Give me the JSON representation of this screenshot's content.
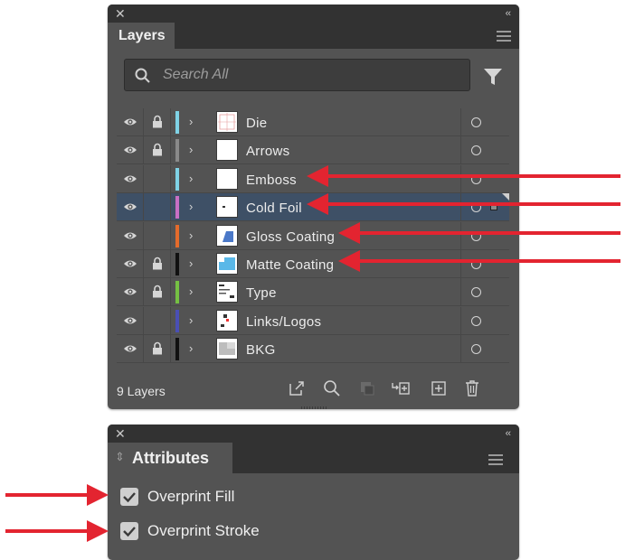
{
  "layers_panel": {
    "title": "Layers",
    "close_glyph": "✕",
    "collapse_glyph": "‹‹",
    "search_placeholder": "Search All",
    "rows": [
      {
        "name": "Die",
        "color": "#7fd3e6",
        "locked": true,
        "visible": true,
        "selected": false
      },
      {
        "name": "Arrows",
        "color": "#8a8a8a",
        "locked": true,
        "visible": true,
        "selected": false
      },
      {
        "name": "Emboss",
        "color": "#7fd3e6",
        "locked": false,
        "visible": true,
        "selected": false
      },
      {
        "name": "Cold Foil",
        "color": "#c86fc4",
        "locked": false,
        "visible": true,
        "selected": true
      },
      {
        "name": "Gloss Coating",
        "color": "#e46b2b",
        "locked": false,
        "visible": true,
        "selected": false
      },
      {
        "name": "Matte Coating",
        "color": "#111111",
        "locked": true,
        "visible": true,
        "selected": false
      },
      {
        "name": "Type",
        "color": "#75c043",
        "locked": true,
        "visible": true,
        "selected": false
      },
      {
        "name": "Links/Logos",
        "color": "#4a4fb5",
        "locked": false,
        "visible": true,
        "selected": false
      },
      {
        "name": "BKG",
        "color": "#111111",
        "locked": true,
        "visible": true,
        "selected": false
      }
    ],
    "chevron_glyph": "›",
    "footer_count": "9 Layers",
    "footer_icons": [
      "export-icon",
      "locate-icon",
      "clipping-mask-icon",
      "sublayer-icon",
      "new-layer-icon",
      "trash-icon"
    ]
  },
  "attributes_panel": {
    "title": "Attributes",
    "close_glyph": "✕",
    "collapse_glyph": "‹‹",
    "updown_glyph": "⇕",
    "options": [
      {
        "label": "Overprint Fill",
        "checked": true
      },
      {
        "label": "Overprint Stroke",
        "checked": true
      }
    ]
  },
  "colors": {
    "arrow": "#e32430",
    "panel_bg": "#535353",
    "topbar_bg": "#323232",
    "selected_row": "#3e5066"
  }
}
